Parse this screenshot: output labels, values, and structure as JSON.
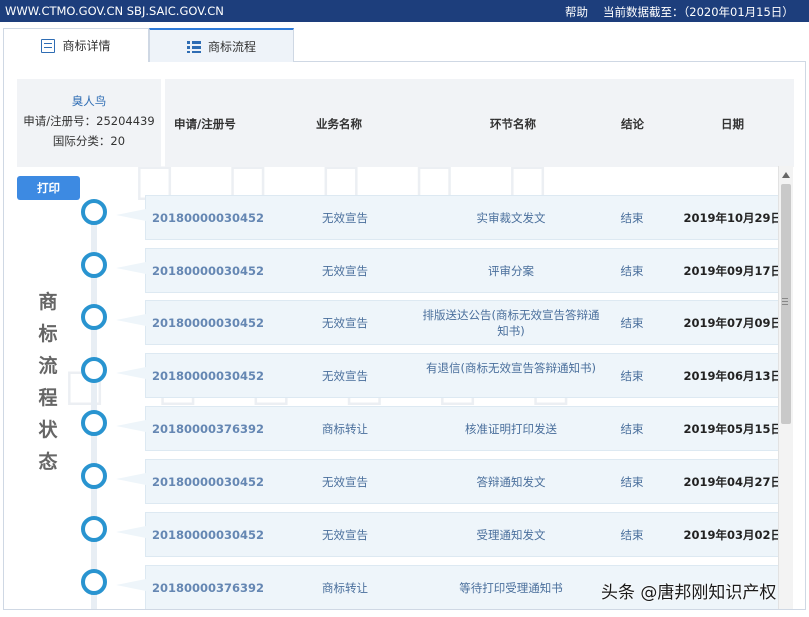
{
  "topbar": {
    "sites": "WWW.CTMO.GOV.CN SBJ.SAIC.GOV.CN",
    "help": "帮助",
    "date_label": "当前数据截至：（2020年01月15日）"
  },
  "tabs": [
    {
      "label": "商标详情",
      "icon": "document-icon"
    },
    {
      "label": "商标流程",
      "icon": "list-icon"
    }
  ],
  "info": {
    "name": "臭人鸟",
    "reg_no": "申请/注册号：25204439",
    "class": "国际分类：20"
  },
  "columns": {
    "reg": "申请/注册号",
    "biz": "业务名称",
    "step": "环节名称",
    "result": "结论",
    "date": "日期"
  },
  "print_label": "打印",
  "vertical_title": [
    "商",
    "标",
    "流",
    "程",
    "状",
    "态"
  ],
  "rows": [
    {
      "reg": "20180000030452",
      "biz": "无效宣告",
      "step": "实审裁文发文",
      "result": "结束",
      "date": "2019年10月29日"
    },
    {
      "reg": "20180000030452",
      "biz": "无效宣告",
      "step": "评审分案",
      "result": "结束",
      "date": "2019年09月17日"
    },
    {
      "reg": "20180000030452",
      "biz": "无效宣告",
      "step": "排版送达公告(商标无效宣告答辩通知书)",
      "result": "结束",
      "date": "2019年07月09日"
    },
    {
      "reg": "20180000030452",
      "biz": "无效宣告",
      "step": "有退信(商标无效宣告答辩通知书)",
      "result": "结束",
      "date": "2019年06月13日"
    },
    {
      "reg": "20180000376392",
      "biz": "商标转让",
      "step": "核准证明打印发送",
      "result": "结束",
      "date": "2019年05月15日"
    },
    {
      "reg": "20180000030452",
      "biz": "无效宣告",
      "step": "答辩通知发文",
      "result": "结束",
      "date": "2019年04月27日"
    },
    {
      "reg": "20180000030452",
      "biz": "无效宣告",
      "step": "受理通知发文",
      "result": "结束",
      "date": "2019年03月02日"
    },
    {
      "reg": "20180000376392",
      "biz": "商标转让",
      "step": "等待打印受理通知书",
      "result": "",
      "date": ""
    }
  ],
  "footer_watermark": "头条 @唐邦刚知识产权"
}
